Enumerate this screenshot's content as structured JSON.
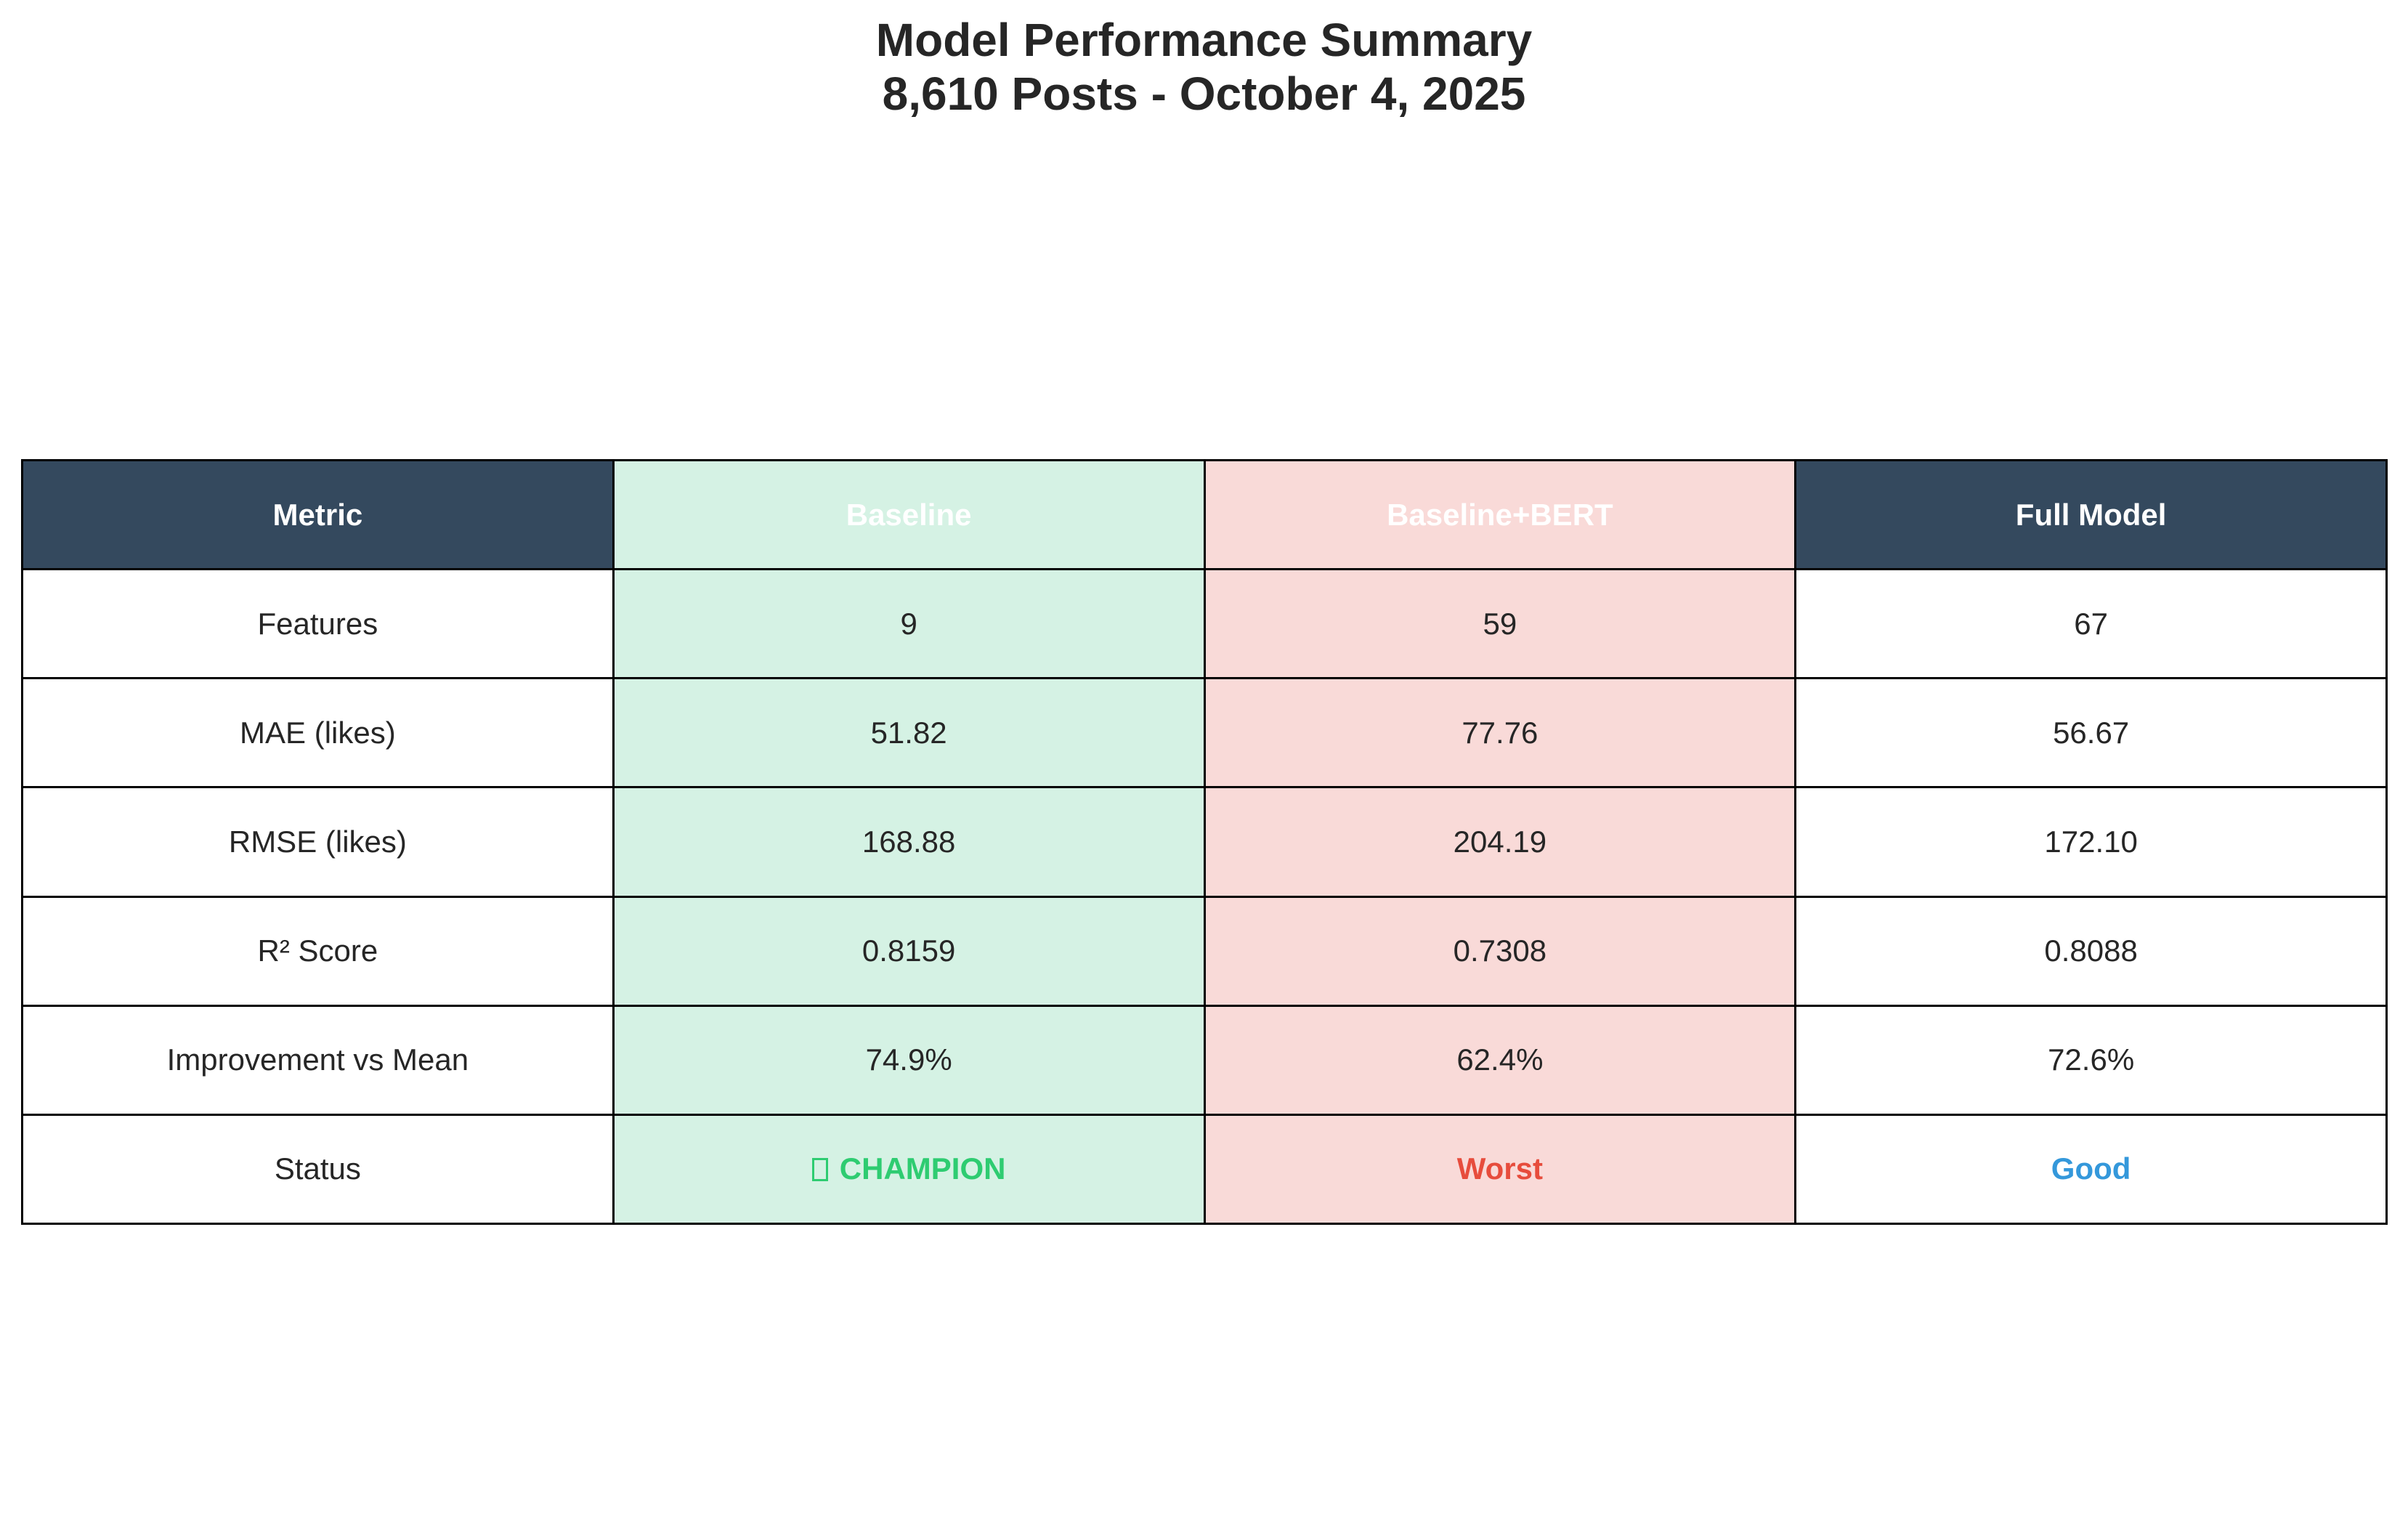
{
  "chart_data": {
    "type": "table",
    "title": "Model Performance Summary",
    "subtitle": "8,610 Posts - October 4, 2025",
    "columns": [
      {
        "label": "Metric",
        "header_bg": "#34495e",
        "cell_bg": "#ffffff"
      },
      {
        "label": "Baseline",
        "header_bg": "#d5f2e4",
        "cell_bg": "#d5f2e4"
      },
      {
        "label": "Baseline+BERT",
        "header_bg": "#f9dad8",
        "cell_bg": "#f9dad8"
      },
      {
        "label": "Full Model",
        "header_bg": "#34495e",
        "cell_bg": "#ffffff"
      }
    ],
    "rows": [
      {
        "metric": "Features",
        "values": [
          "9",
          "59",
          "67"
        ]
      },
      {
        "metric": "MAE (likes)",
        "values": [
          "51.82",
          "77.76",
          "56.67"
        ]
      },
      {
        "metric": "RMSE (likes)",
        "values": [
          "168.88",
          "204.19",
          "172.10"
        ]
      },
      {
        "metric": "R² Score",
        "values": [
          "0.8159",
          "0.7308",
          "0.8088"
        ]
      },
      {
        "metric": "Improvement vs Mean",
        "values": [
          "74.9%",
          "62.4%",
          "72.6%"
        ]
      }
    ],
    "status_row": {
      "metric": "Status",
      "values": [
        {
          "text": "CHAMPION",
          "color": "#2ecc71",
          "icon": "missing-glyph-box-icon"
        },
        {
          "text": "Worst",
          "color": "#e74c3c"
        },
        {
          "text": "Good",
          "color": "#3498db"
        }
      ]
    }
  }
}
